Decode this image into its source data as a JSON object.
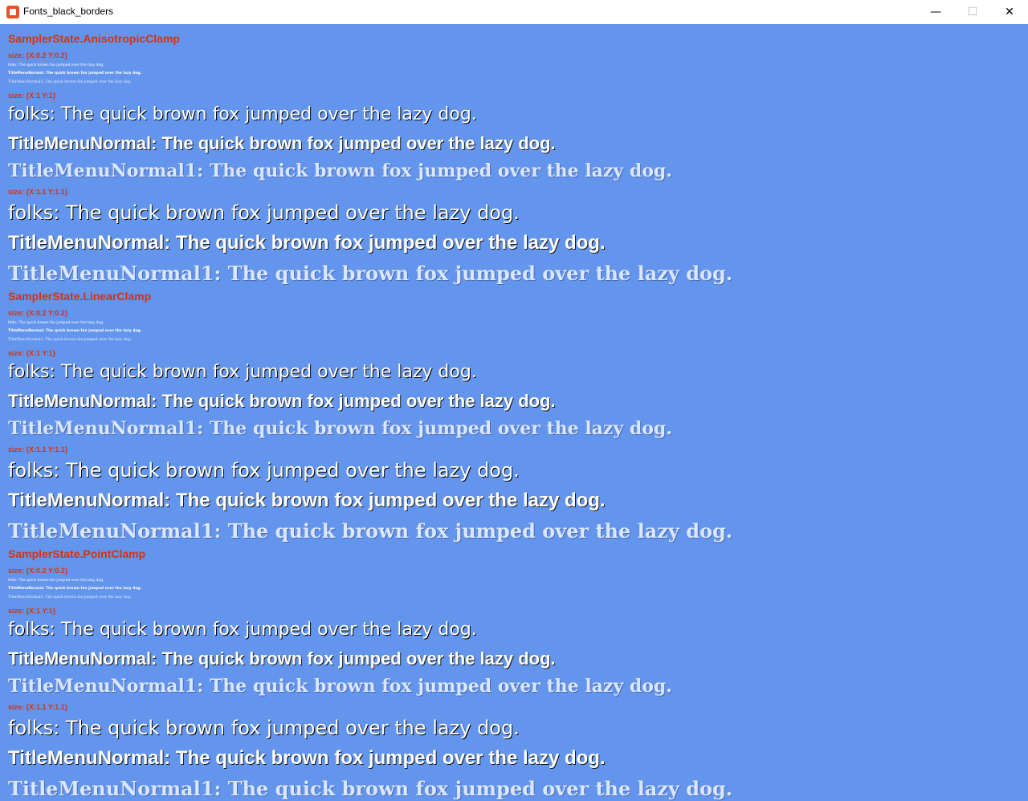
{
  "window": {
    "title": "Fonts_black_borders",
    "minimize": "—",
    "maximize": "☐",
    "close": "✕"
  },
  "sections": [
    {
      "sampler": "SamplerState.AnisotropicClamp",
      "size_small": "size: {X:0.2 Y:0.2}",
      "size_1": "size: {X:1 Y:1}",
      "size_11": "size: {X:1.1 Y:1.1}"
    },
    {
      "sampler": "SamplerState.LinearClamp",
      "size_small": "size: {X:0.2 Y:0.2}",
      "size_1": "size: {X:1 Y:1}",
      "size_11": "size: {X:1.1 Y:1.1}"
    },
    {
      "sampler": "SamplerState.PointClamp",
      "size_small": "size: {X:0.2 Y:0.2}",
      "size_1": "size: {X:1 Y:1}",
      "size_11": "size: {X:1.1 Y:1.1}"
    }
  ],
  "text": {
    "folks": "folks: The quick brown fox jumped over the lazy dog.",
    "menu": "TitleMenuNormal: The quick brown fox jumped over the lazy dog.",
    "menu1": "TitleMenuNormal1: The quick brown fox jumped over the lazy dog."
  },
  "colors": {
    "background": "#6495ED",
    "label": "#d33310"
  }
}
